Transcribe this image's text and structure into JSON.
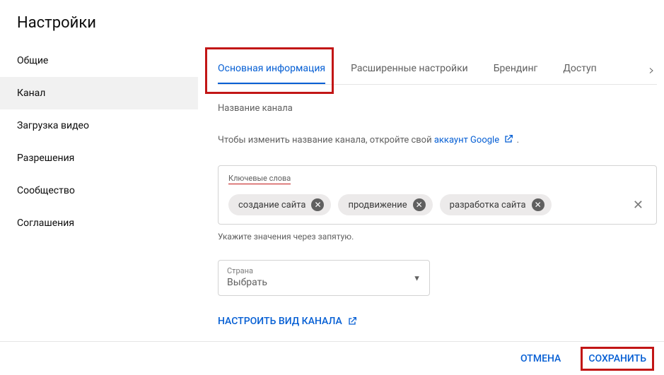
{
  "header": {
    "title": "Настройки"
  },
  "sidebar": {
    "items": [
      {
        "label": "Общие"
      },
      {
        "label": "Канал"
      },
      {
        "label": "Загрузка видео"
      },
      {
        "label": "Разрешения"
      },
      {
        "label": "Сообщество"
      },
      {
        "label": "Соглашения"
      }
    ],
    "activeIndex": 1
  },
  "tabs": {
    "items": [
      {
        "label": "Основная информация"
      },
      {
        "label": "Расширенные настройки"
      },
      {
        "label": "Брендинг"
      },
      {
        "label": "Доступ"
      }
    ],
    "activeIndex": 0
  },
  "content": {
    "channelNameLabel": "Название канала",
    "changeHintPrefix": "Чтобы изменить название канала, откройте свой ",
    "changeHintLink": "аккаунт Google",
    "keywordsLabel": "Ключевые слова",
    "keywords": [
      "создание сайта",
      "продвижение",
      "разработка сайта"
    ],
    "keywordsHelper": "Укажите значения через запятую.",
    "countryLabel": "Страна",
    "countryValue": "Выбрать",
    "configureLink": "НАСТРОИТЬ ВИД КАНАЛА"
  },
  "footer": {
    "cancel": "ОТМЕНА",
    "save": "СОХРАНИТЬ"
  }
}
